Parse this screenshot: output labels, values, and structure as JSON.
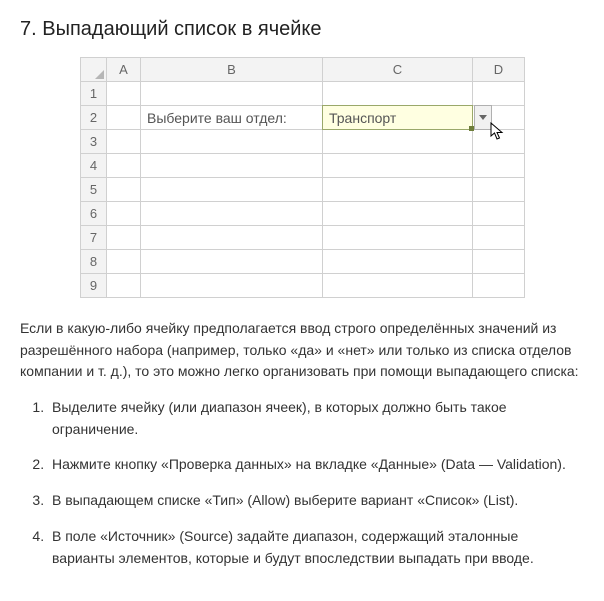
{
  "heading": "7. Выпадающий список в ячейке",
  "sheet": {
    "cols": [
      "A",
      "B",
      "C",
      "D"
    ],
    "rows": [
      "1",
      "2",
      "3",
      "4",
      "5",
      "6",
      "7",
      "8",
      "9"
    ],
    "label_cell": "Выберите ваш отдел:",
    "dv_value": "Транспорт"
  },
  "paragraph": "Если в какую-либо ячейку предполагается ввод строго определённых значений из разрешённого набора (например, только «да» и «нет» или только из списка отделов компании и т. д.), то это можно легко организовать при помощи выпадающего списка:",
  "steps": [
    "Выделите ячейку (или диапазон ячеек), в которых должно быть такое ограничение.",
    "Нажмите кнопку «Проверка данных» на вкладке «Данные» (Data — Validation).",
    "В выпадающем списке «Тип» (Allow) выберите вариант «Список» (List).",
    "В поле «Источник» (Source) задайте диапазон, содержащий эталонные варианты элементов, которые и будут впоследствии выпадать при вводе."
  ]
}
